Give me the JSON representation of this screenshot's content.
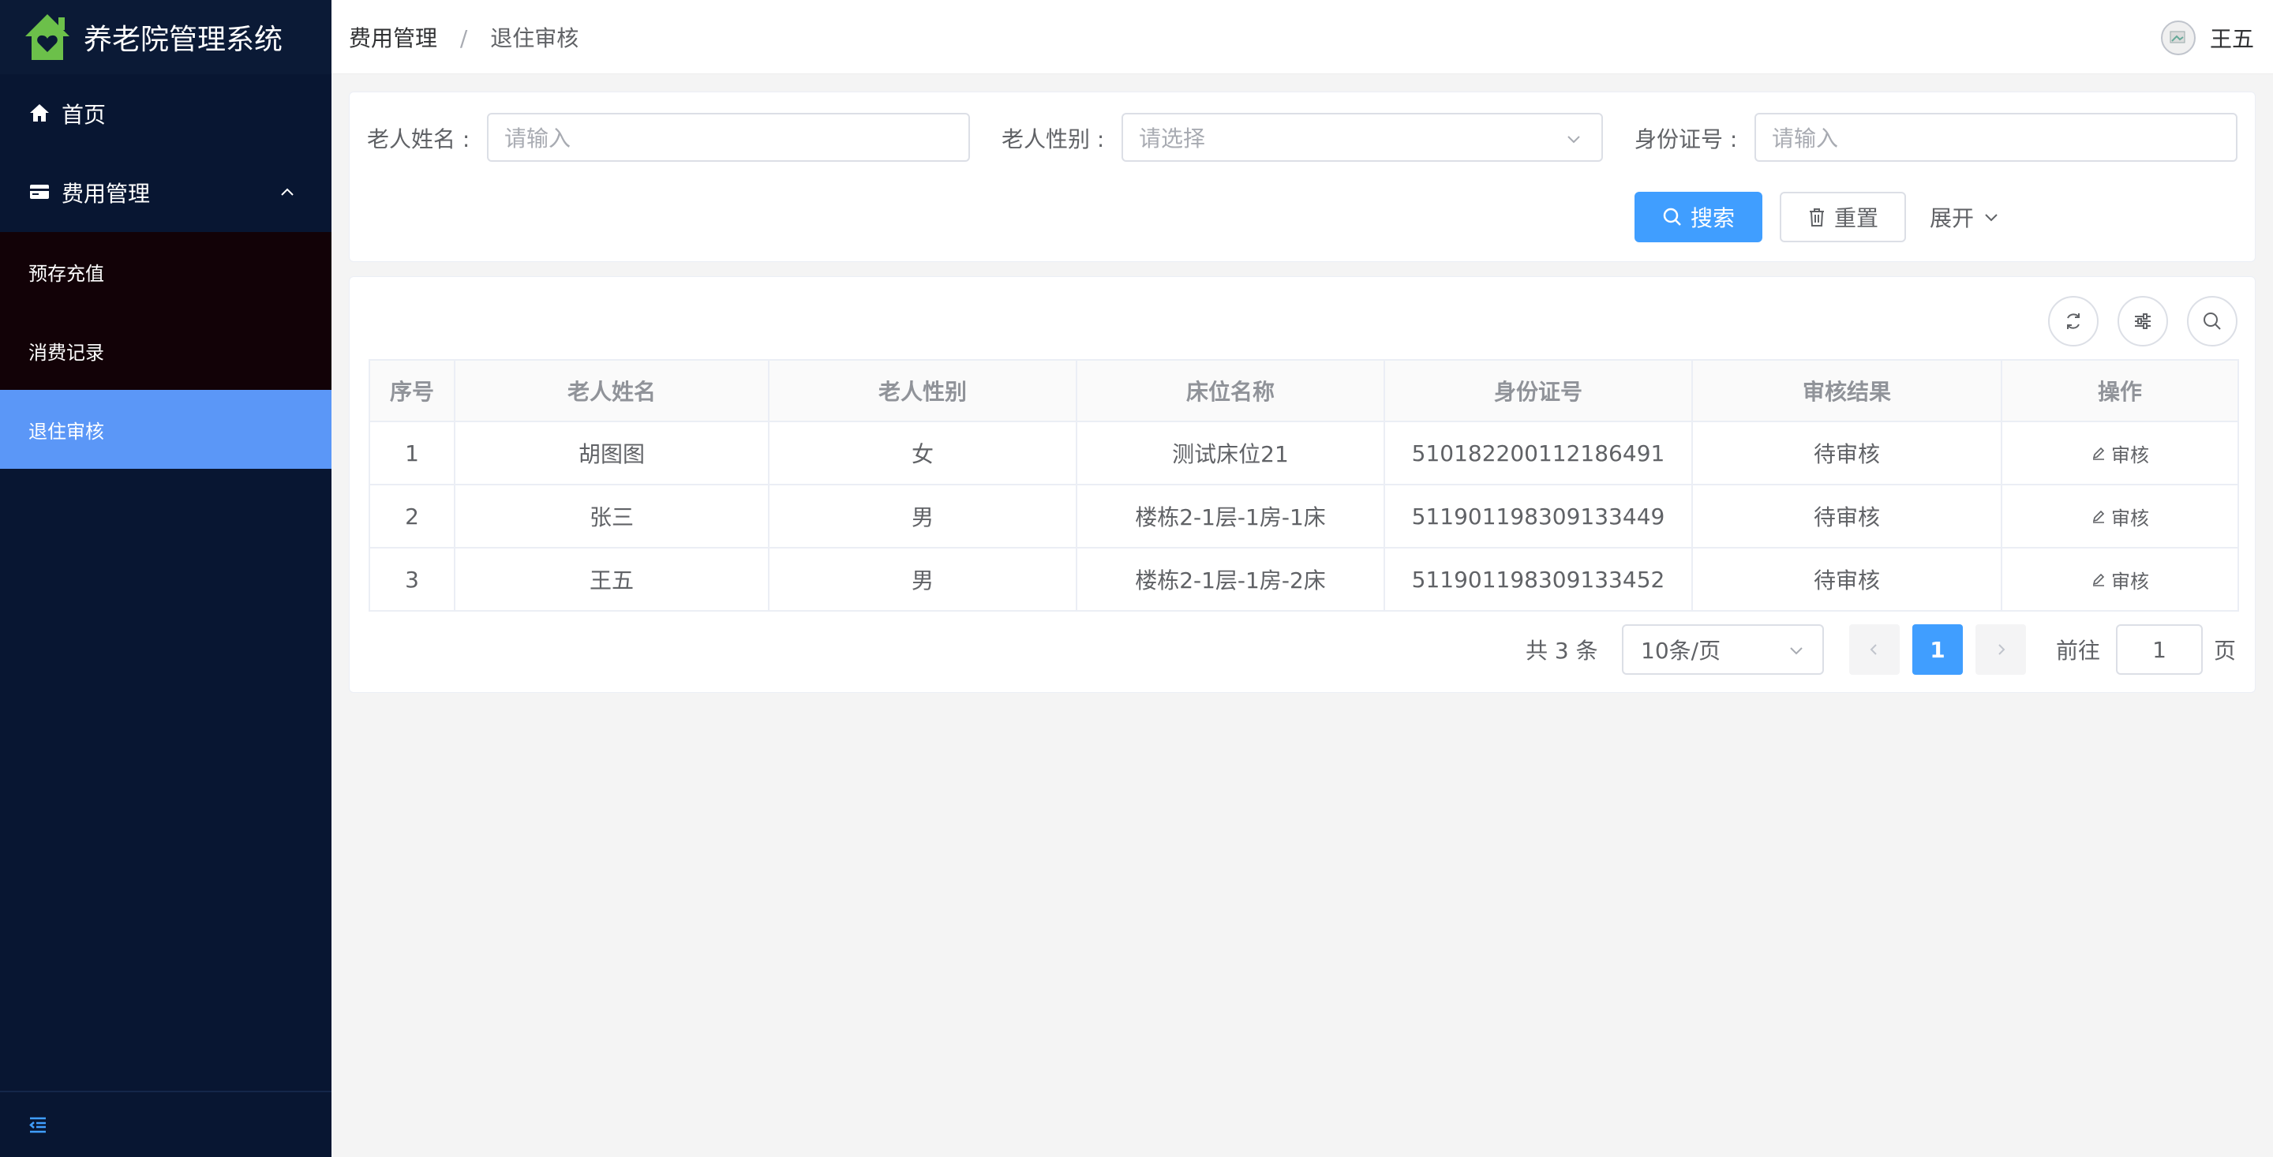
{
  "app": {
    "title": "养老院管理系统"
  },
  "colors": {
    "sidebar_bg": "#081632",
    "active_item": "#5b97f7",
    "primary": "#409eff",
    "logo_green": "#6cc04a"
  },
  "sidebar": {
    "items": [
      {
        "label": "首页",
        "icon": "home-icon"
      },
      {
        "label": "费用管理",
        "icon": "card-icon",
        "expanded": true,
        "children": [
          {
            "label": "预存充值"
          },
          {
            "label": "消费记录"
          },
          {
            "label": "退住审核",
            "active": true
          }
        ]
      }
    ]
  },
  "header": {
    "breadcrumb": [
      "费用管理",
      "退住审核"
    ],
    "separator": "/",
    "user_name": "王五"
  },
  "search": {
    "name_label": "老人姓名 :",
    "name_placeholder": "请输入",
    "gender_label": "老人性别 :",
    "gender_placeholder": "请选择",
    "id_label": "身份证号 :",
    "id_placeholder": "请输入",
    "search_button": "搜索",
    "reset_button": "重置",
    "expand_label": "展开"
  },
  "table": {
    "columns": [
      "序号",
      "老人姓名",
      "老人性别",
      "床位名称",
      "身份证号",
      "审核结果",
      "操作"
    ],
    "rows": [
      {
        "index": "1",
        "name": "胡图图",
        "gender": "女",
        "bed": "测试床位21",
        "id_no": "510182200112186491",
        "status": "待审核",
        "action": "审核"
      },
      {
        "index": "2",
        "name": "张三",
        "gender": "男",
        "bed": "楼栋2-1层-1房-1床",
        "id_no": "511901198309133449",
        "status": "待审核",
        "action": "审核"
      },
      {
        "index": "3",
        "name": "王五",
        "gender": "男",
        "bed": "楼栋2-1层-1房-2床",
        "id_no": "511901198309133452",
        "status": "待审核",
        "action": "审核"
      }
    ]
  },
  "pagination": {
    "total_text": "共 3 条",
    "page_size": "10条/页",
    "current_page": "1",
    "goto_label": "前往",
    "goto_value": "1",
    "page_suffix": "页"
  }
}
